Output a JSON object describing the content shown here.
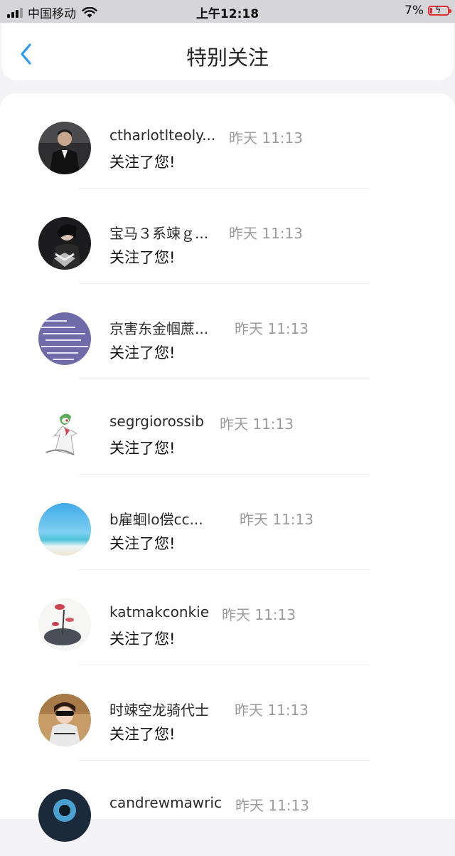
{
  "status_bar": {
    "carrier": "中国移动",
    "time": "上午12:18",
    "battery": "7%",
    "battery_level": 0.07
  },
  "nav": {
    "title": "特别关注",
    "back_icon": "chevron-left-icon",
    "accent_color": "#2b9cf2"
  },
  "items": [
    {
      "name": "ctharlotlteoly...",
      "time": "昨天 11:13",
      "action": "关注了您!"
    },
    {
      "name": "宝马３系竦ｇ...",
      "time": "昨天 11:13",
      "action": "关注了您!"
    },
    {
      "name": "京害东金帼蔗...",
      "time": "昨天 11:13",
      "action": "关注了您!"
    },
    {
      "name": "segrgiorossib",
      "time": "昨天 11:13",
      "action": "关注了您!"
    },
    {
      "name": "b雇蛔lo偿cc...",
      "time": "昨天 11:13",
      "action": "关注了您!"
    },
    {
      "name": "katmakconkie",
      "time": "昨天 11:13",
      "action": "关注了您!"
    },
    {
      "name": "时竦空龙骑代士",
      "time": "昨天 11:13",
      "action": "关注了您!"
    },
    {
      "name": "candrewmawric",
      "time": "昨天 11:13",
      "action": ""
    }
  ]
}
